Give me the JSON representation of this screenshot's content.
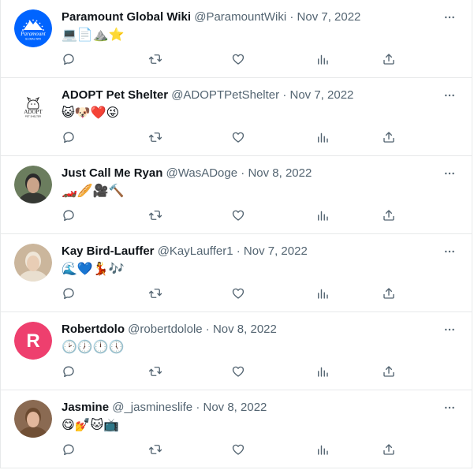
{
  "tweets": [
    {
      "name": "Paramount Global Wiki",
      "handle": "@ParamountWiki",
      "separator": "·",
      "date": "Nov 7, 2022",
      "emojis": "💻📄⛰️⭐",
      "avatar": {
        "type": "paramount",
        "bg": "#0064FF",
        "logo_text": "Paramount",
        "logo_subtext": "GLOBAL WIKI"
      }
    },
    {
      "name": "ADOPT Pet Shelter",
      "handle": "@ADOPTPetShelter",
      "separator": "·",
      "date": "Nov 7, 2022",
      "emojis": "😺🐶❤️😜",
      "avatar": {
        "type": "adopt",
        "bg": "#ffffff",
        "logo_text": "ADOPT",
        "logo_subtext": "PET SHELTER"
      }
    },
    {
      "name": "Just Call Me Ryan",
      "handle": "@WasADoge",
      "separator": "·",
      "date": "Nov 8, 2022",
      "emojis": "🏎️🥖🎥🔨",
      "avatar": {
        "type": "photo",
        "bg": "#7a8a6a"
      }
    },
    {
      "name": "Kay Bird-Lauffer",
      "handle": "@KayLauffer1",
      "separator": "·",
      "date": "Nov 7, 2022",
      "emojis": "🌊💙💃🎶",
      "avatar": {
        "type": "photo",
        "bg": "#d8c6b0"
      }
    },
    {
      "name": "Robertdolo",
      "handle": "@robertdolole",
      "separator": "·",
      "date": "Nov 8, 2022",
      "emojis": "🕑🕖🕛🕔",
      "avatar": {
        "type": "letter",
        "bg": "#EE3F6E",
        "letter": "R"
      }
    },
    {
      "name": "Jasmine",
      "handle": "@_jasmineslife",
      "separator": "·",
      "date": "Nov 8, 2022",
      "emojis": "😋💅🐱📺",
      "avatar": {
        "type": "photo",
        "bg": "#a07a58"
      }
    }
  ],
  "icons": {
    "more": "more-horizontal-icon",
    "reply": "reply-icon",
    "retweet": "retweet-icon",
    "like": "like-icon",
    "views": "views-icon",
    "share": "share-icon"
  },
  "colors": {
    "text": "#0f1419",
    "muted": "#536471",
    "divider": "#e7e9ea"
  }
}
